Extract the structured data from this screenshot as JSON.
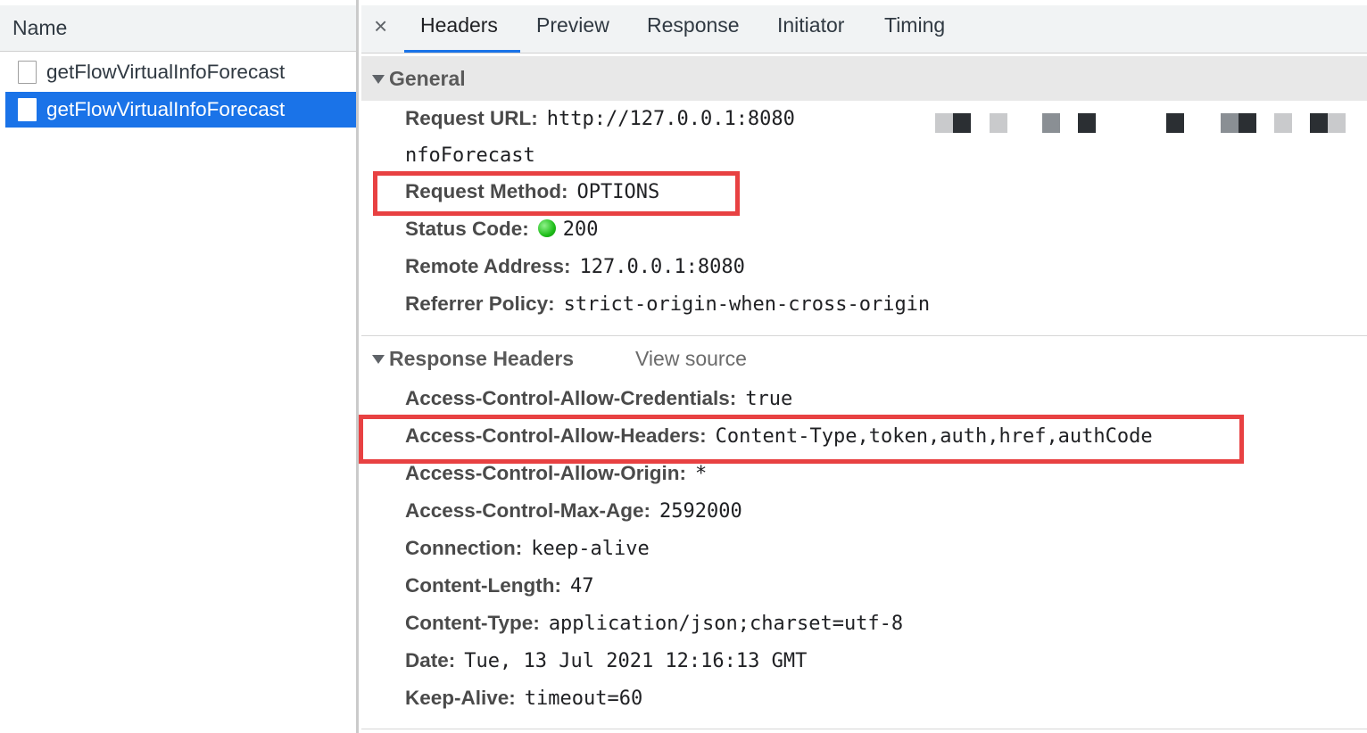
{
  "request_list": {
    "column_title": "Name",
    "requests": [
      {
        "name": "getFlowVirtualInfoForecast",
        "selected": false
      },
      {
        "name": "getFlowVirtualInfoForecast",
        "selected": true
      }
    ],
    "selected_color": "#1a73e8"
  },
  "tabs": {
    "close_icon": "close-icon",
    "close_glyph": "×",
    "items": [
      "Headers",
      "Preview",
      "Response",
      "Initiator",
      "Timing"
    ],
    "active": "Headers"
  },
  "general": {
    "title": "General",
    "request_url_key": "Request URL:",
    "request_url_value": "http://127.0.0.1:8080",
    "request_url_tail": "nfoForecast",
    "request_method_key": "Request Method:",
    "request_method_value": "OPTIONS",
    "status_code_key": "Status Code:",
    "status_code_value": "200",
    "status_color": "#1fbe1a",
    "remote_address_key": "Remote Address:",
    "remote_address_value": "127.0.0.1:8080",
    "referrer_policy_key": "Referrer Policy:",
    "referrer_policy_value": "strict-origin-when-cross-origin"
  },
  "response_headers": {
    "title": "Response Headers",
    "view_source": "View source",
    "items": [
      {
        "key": "Access-Control-Allow-Credentials:",
        "value": "true"
      },
      {
        "key": "Access-Control-Allow-Headers:",
        "value": "Content-Type,token,auth,href,authCode"
      },
      {
        "key": "Access-Control-Allow-Origin:",
        "value": "*"
      },
      {
        "key": "Access-Control-Max-Age:",
        "value": "2592000"
      },
      {
        "key": "Connection:",
        "value": "keep-alive"
      },
      {
        "key": "Content-Length:",
        "value": "47"
      },
      {
        "key": "Content-Type:",
        "value": "application/json;charset=utf-8"
      },
      {
        "key": "Date:",
        "value": "Tue, 13 Jul 2021 12:16:13 GMT"
      },
      {
        "key": "Keep-Alive:",
        "value": "timeout=60"
      }
    ]
  },
  "highlight_color": "#e84142"
}
